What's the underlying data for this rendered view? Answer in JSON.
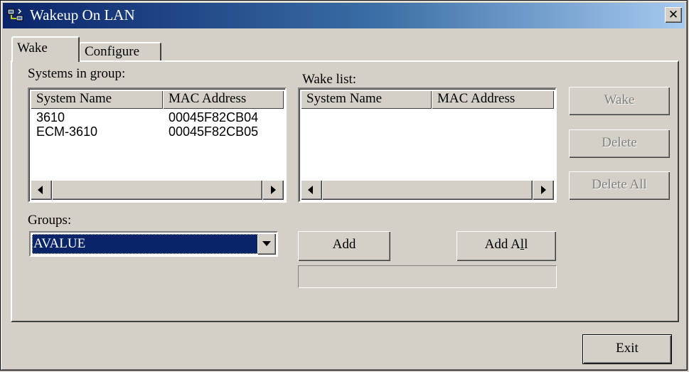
{
  "window": {
    "title": "Wakeup On LAN",
    "close_label": "✕"
  },
  "tabs": [
    {
      "label": "Wake"
    },
    {
      "label": "Configure"
    }
  ],
  "systems_group": {
    "label": "Systems in group:",
    "columns": [
      "System Name",
      "MAC Address"
    ],
    "rows": [
      {
        "name": "3610",
        "mac": "00045F82CB04"
      },
      {
        "name": "ECM-3610",
        "mac": "00045F82CB05"
      }
    ]
  },
  "wake_list": {
    "label": "Wake list:",
    "columns": [
      "System Name",
      "MAC Address"
    ],
    "rows": []
  },
  "buttons": {
    "wake": "Wake",
    "delete": "Delete",
    "delete_all": "Delete All",
    "add": "Add",
    "add_all": "Add All",
    "exit": "Exit"
  },
  "groups": {
    "label": "Groups:",
    "selected": "AVALUE"
  },
  "progress": {
    "value": 0
  },
  "colors": {
    "selection": "#0a246a",
    "face": "#d4d0c8",
    "title_start": "#0a246a",
    "title_end": "#a6caf0"
  }
}
